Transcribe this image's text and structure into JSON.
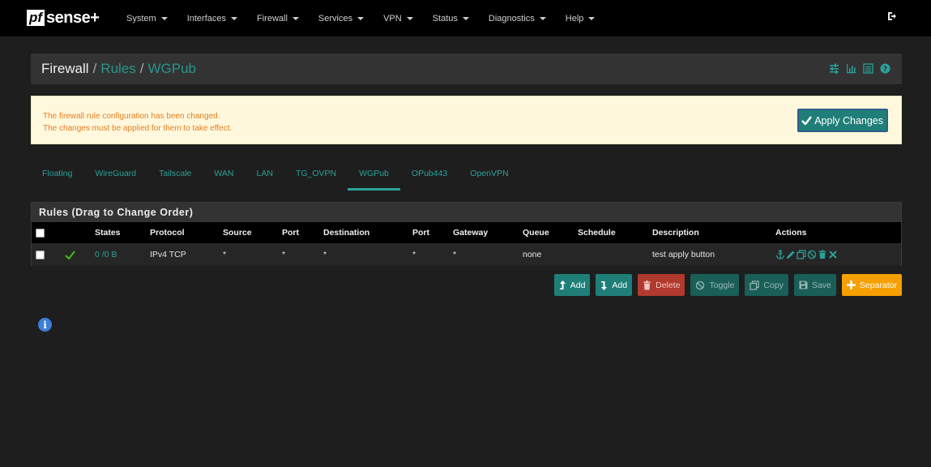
{
  "brand": {
    "logo_pf": "pf",
    "logo_sense": "sense+"
  },
  "nav": {
    "items": [
      {
        "label": "System"
      },
      {
        "label": "Interfaces"
      },
      {
        "label": "Firewall"
      },
      {
        "label": "Services"
      },
      {
        "label": "VPN"
      },
      {
        "label": "Status"
      },
      {
        "label": "Diagnostics"
      },
      {
        "label": "Help"
      }
    ],
    "logout_icon": "sign-out-icon"
  },
  "breadcrumb": {
    "part1": "Firewall",
    "part2": "Rules",
    "part3": "WGPub",
    "sep": "/",
    "icons": [
      "sliders-icon",
      "bar-chart-icon",
      "list-icon",
      "question-circle-icon"
    ]
  },
  "alert": {
    "line1": "The firewall rule configuration has been changed.",
    "line2": "The changes must be applied for them to take effect.",
    "apply_label": "Apply Changes"
  },
  "tabs": [
    {
      "label": "Floating"
    },
    {
      "label": "WireGuard"
    },
    {
      "label": "Tailscale"
    },
    {
      "label": "WAN"
    },
    {
      "label": "LAN"
    },
    {
      "label": "TG_OVPN"
    },
    {
      "label": "WGPub",
      "active": true
    },
    {
      "label": "OPub443"
    },
    {
      "label": "OpenVPN"
    }
  ],
  "rules_panel": {
    "title": "Rules (Drag to Change Order)",
    "columns": {
      "states": "States",
      "protocol": "Protocol",
      "source": "Source",
      "port": "Port",
      "destination": "Destination",
      "port2": "Port",
      "gateway": "Gateway",
      "queue": "Queue",
      "schedule": "Schedule",
      "description": "Description",
      "actions": "Actions"
    },
    "rows": [
      {
        "states": "0 /0 B",
        "protocol": "IPv4 TCP",
        "source": "*",
        "port": "*",
        "destination": "*",
        "port2": "*",
        "gateway": "*",
        "queue": "none",
        "schedule": "",
        "description": "test apply button"
      }
    ]
  },
  "buttons": {
    "add_top": "Add",
    "add_bottom": "Add",
    "delete": "Delete",
    "toggle": "Toggle",
    "copy": "Copy",
    "save": "Save",
    "separator": "Separator"
  },
  "colors": {
    "accent": "#2aa198",
    "alert_bg": "#fff8dc",
    "alert_text": "#e67e22",
    "button_teal": "#1f7f78",
    "button_red": "#b03a2e",
    "button_orange": "#f5a000"
  }
}
